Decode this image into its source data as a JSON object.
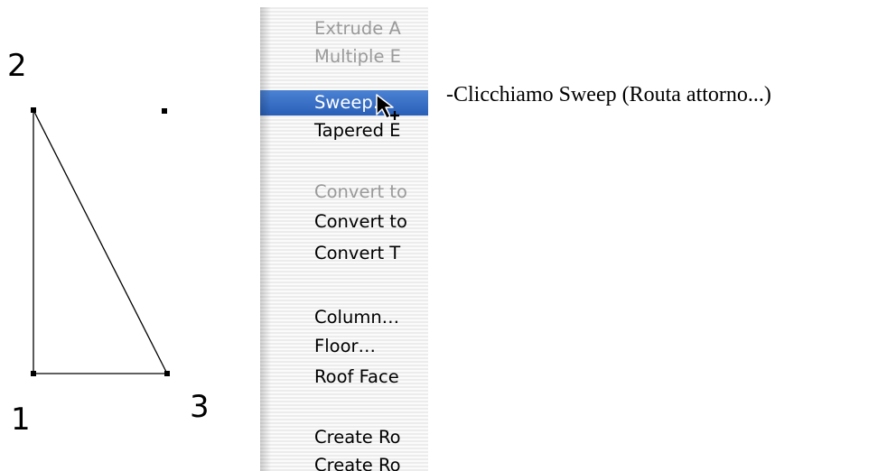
{
  "drawing": {
    "point_labels": [
      "2",
      "1",
      "3"
    ]
  },
  "menu": {
    "items": [
      {
        "label": "Extrude A",
        "state": "disabled"
      },
      {
        "label": "Multiple E",
        "state": "disabled"
      },
      {
        "label": "Sweep…",
        "state": "highlighted"
      },
      {
        "label": "Tapered E",
        "state": "enabled"
      },
      {
        "label": "Convert to",
        "state": "disabled"
      },
      {
        "label": "Convert to",
        "state": "enabled"
      },
      {
        "label": "Convert T",
        "state": "enabled"
      },
      {
        "label": "Column…",
        "state": "enabled"
      },
      {
        "label": "Floor…",
        "state": "enabled"
      },
      {
        "label": "Roof Face",
        "state": "enabled"
      },
      {
        "label": "Create Ro",
        "state": "enabled"
      },
      {
        "label": "Create Ro",
        "state": "enabled"
      }
    ]
  },
  "caption": "-Clicchiamo Sweep (Routa attorno...)",
  "colors": {
    "highlight": "#2f66c0",
    "disabled_text": "#9a9a9a"
  }
}
